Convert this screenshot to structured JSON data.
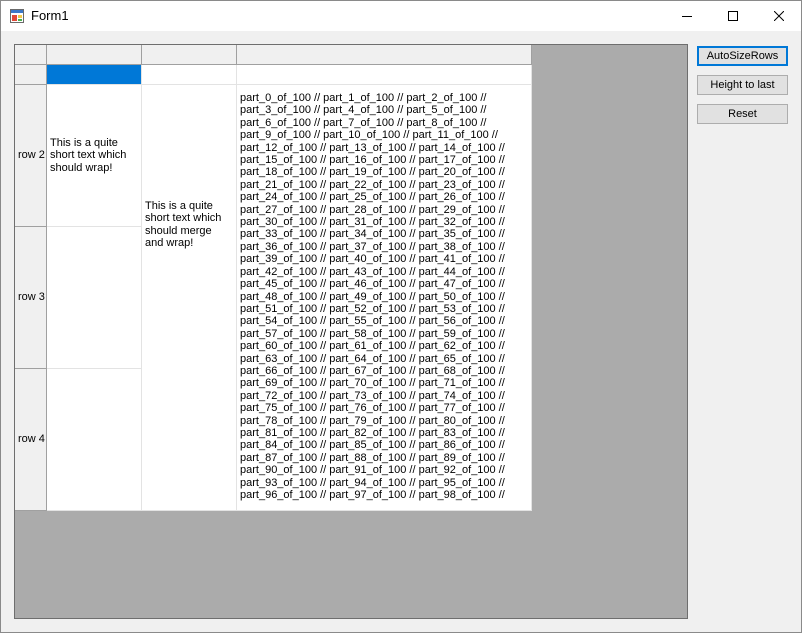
{
  "window": {
    "title": "Form1"
  },
  "grid": {
    "rows": [
      {
        "header": "",
        "col1": "",
        "col2": "",
        "col3": ""
      },
      {
        "header": "row 2",
        "col1": "This is a quite short text which should wrap!"
      },
      {
        "header": "row 3"
      },
      {
        "header": "row 4"
      }
    ],
    "merged_text": "This is a quite short text which should merge and wrap!",
    "long_text": "part_0_of_100 // part_1_of_100 // part_2_of_100 // part_3_of_100 // part_4_of_100 // part_5_of_100 // part_6_of_100 // part_7_of_100 // part_8_of_100 // part_9_of_100 // part_10_of_100 // part_11_of_100 // part_12_of_100 // part_13_of_100 // part_14_of_100 // part_15_of_100 // part_16_of_100 // part_17_of_100 // part_18_of_100 // part_19_of_100 // part_20_of_100 // part_21_of_100 // part_22_of_100 // part_23_of_100 // part_24_of_100 // part_25_of_100 // part_26_of_100 // part_27_of_100 // part_28_of_100 // part_29_of_100 // part_30_of_100 // part_31_of_100 // part_32_of_100 // part_33_of_100 // part_34_of_100 // part_35_of_100 // part_36_of_100 // part_37_of_100 // part_38_of_100 // part_39_of_100 // part_40_of_100 // part_41_of_100 // part_42_of_100 // part_43_of_100 // part_44_of_100 // part_45_of_100 // part_46_of_100 // part_47_of_100 // part_48_of_100 // part_49_of_100 // part_50_of_100 // part_51_of_100 // part_52_of_100 // part_53_of_100 // part_54_of_100 // part_55_of_100 // part_56_of_100 // part_57_of_100 // part_58_of_100 // part_59_of_100 // part_60_of_100 // part_61_of_100 // part_62_of_100 // part_63_of_100 // part_64_of_100 // part_65_of_100 // part_66_of_100 // part_67_of_100 // part_68_of_100 // part_69_of_100 // part_70_of_100 // part_71_of_100 // part_72_of_100 // part_73_of_100 // part_74_of_100 // part_75_of_100 // part_76_of_100 // part_77_of_100 // part_78_of_100 // part_79_of_100 // part_80_of_100 // part_81_of_100 // part_82_of_100 // part_83_of_100 // part_84_of_100 // part_85_of_100 // part_86_of_100 // part_87_of_100 // part_88_of_100 // part_89_of_100 // part_90_of_100 // part_91_of_100 // part_92_of_100 // part_93_of_100 // part_94_of_100 // part_95_of_100 // part_96_of_100 // part_97_of_100 // part_98_of_100 //"
  },
  "buttons": {
    "autosize": "AutoSizeRows",
    "height_to_last": "Height to last",
    "reset": "Reset"
  },
  "colors": {
    "selection": "#0078d7",
    "grid_background": "#ababab",
    "header": "#f0f0f0"
  }
}
